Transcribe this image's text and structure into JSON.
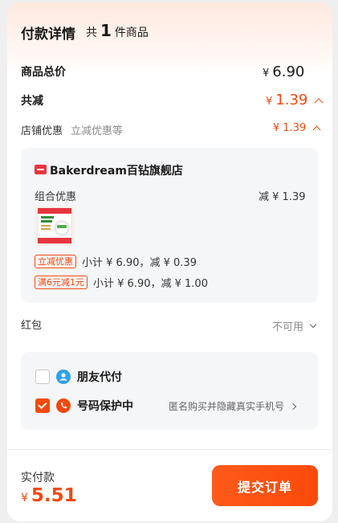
{
  "header": {
    "title": "付款详情",
    "count_prefix": "共",
    "count": "1",
    "count_suffix": "件商品"
  },
  "summary": {
    "total_label": "商品总价",
    "total_currency": "¥",
    "total_value": "6.90",
    "discount_label": "共减",
    "discount_currency": "¥",
    "discount_value": "1.39"
  },
  "store_discount": {
    "label": "店铺优惠",
    "detail": "立减优惠等",
    "currency": "¥",
    "value": "1.39"
  },
  "store": {
    "name": "Bakerdream百钻旗舰店",
    "combo_label": "组合优惠",
    "combo_value": "减 ¥ 1.39",
    "promos": [
      {
        "tag": "立减优惠",
        "text": "小计 ¥ 6.90，减 ¥ 0.39"
      },
      {
        "tag": "满6元减1元",
        "text": "小计 ¥ 6.90，减 ¥ 1.00"
      }
    ],
    "thumb_text": "佰钻·白砂糖"
  },
  "red_packet": {
    "label": "红包",
    "status": "不可用"
  },
  "options": {
    "friend_pay": "朋友代付",
    "privacy": "号码保护中",
    "privacy_desc": "匿名购买并隐藏真实手机号"
  },
  "footer": {
    "pay_label": "实付款",
    "pay_currency": "¥",
    "pay_value": "5.51",
    "submit_label": "提交订单"
  },
  "colors": {
    "accent": "#f2490f",
    "friend_icon": "#2fa2e6",
    "background": "#efefef"
  }
}
